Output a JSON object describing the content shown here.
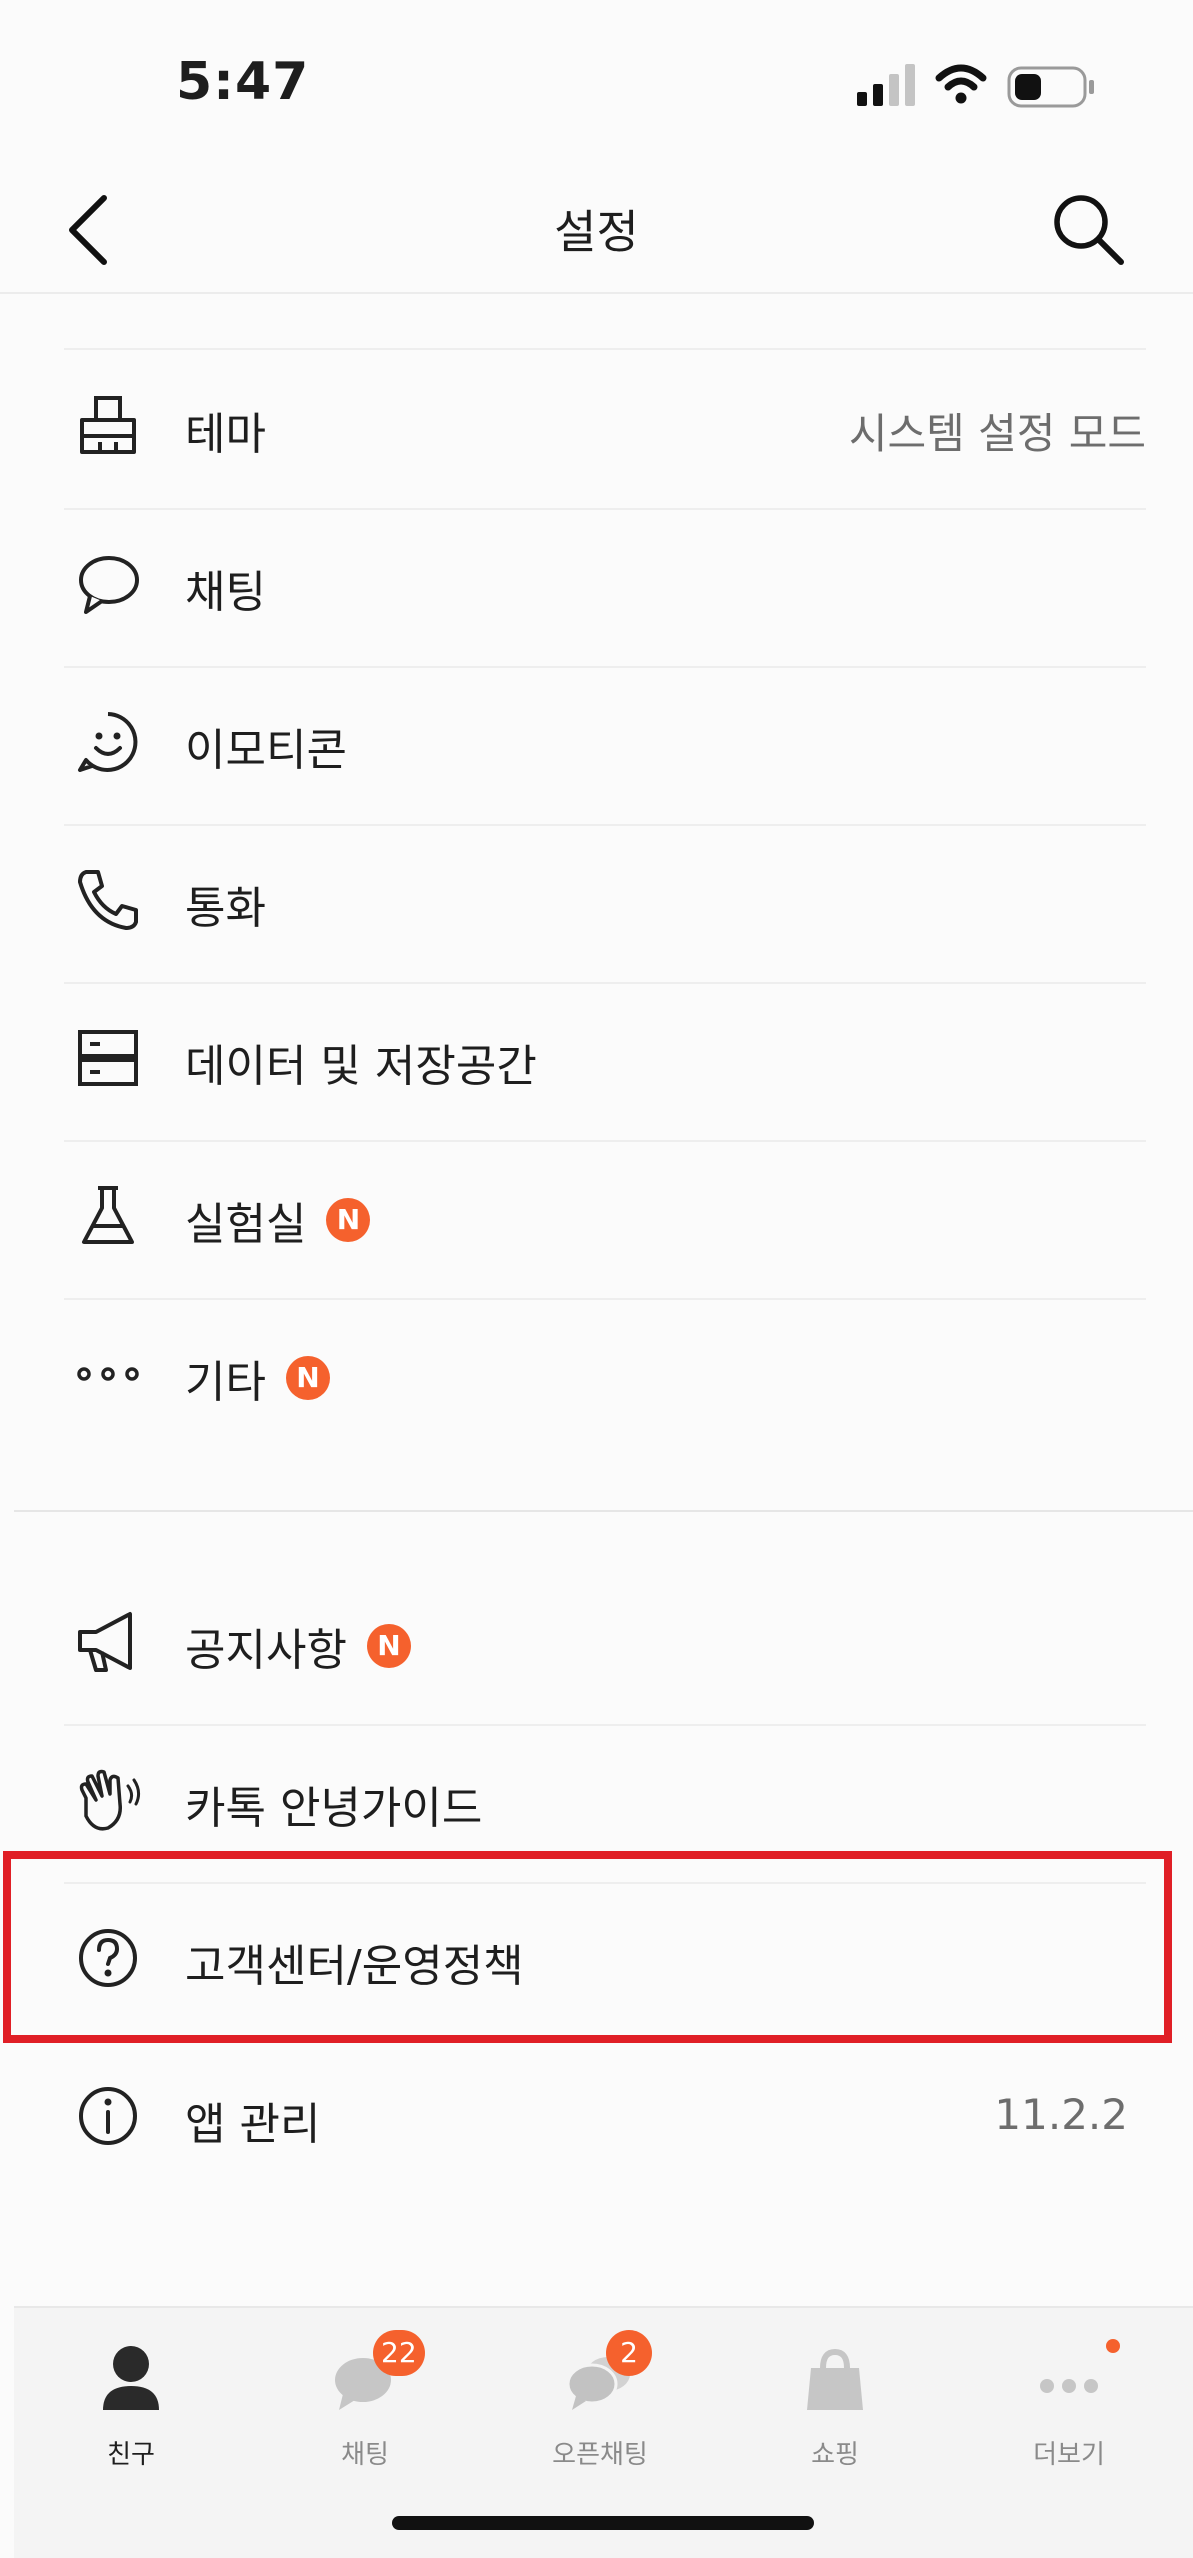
{
  "status_bar": {
    "time": "5:47"
  },
  "nav": {
    "title": "설정"
  },
  "settings": {
    "theme": {
      "label": "테마",
      "value": "시스템 설정 모드"
    },
    "chat": {
      "label": "채팅"
    },
    "emoticon": {
      "label": "이모티콘"
    },
    "call": {
      "label": "통화"
    },
    "data_storage": {
      "label": "데이터 및 저장공간"
    },
    "lab": {
      "label": "실험실",
      "badge": "N"
    },
    "etc": {
      "label": "기타",
      "badge": "N"
    }
  },
  "info": {
    "notice": {
      "label": "공지사항",
      "badge": "N"
    },
    "guide": {
      "label": "카톡 안녕가이드"
    },
    "support": {
      "label": "고객센터/운영정책"
    },
    "app_manage": {
      "label": "앱 관리",
      "value": "11.2.2"
    }
  },
  "tabs": [
    {
      "label": "친구",
      "active": true
    },
    {
      "label": "채팅",
      "badge": "22"
    },
    {
      "label": "오픈채팅",
      "badge": "2"
    },
    {
      "label": "쇼핑"
    },
    {
      "label": "더보기"
    }
  ],
  "colors": {
    "accent": "#f5612d",
    "highlight": "#e01f26"
  }
}
